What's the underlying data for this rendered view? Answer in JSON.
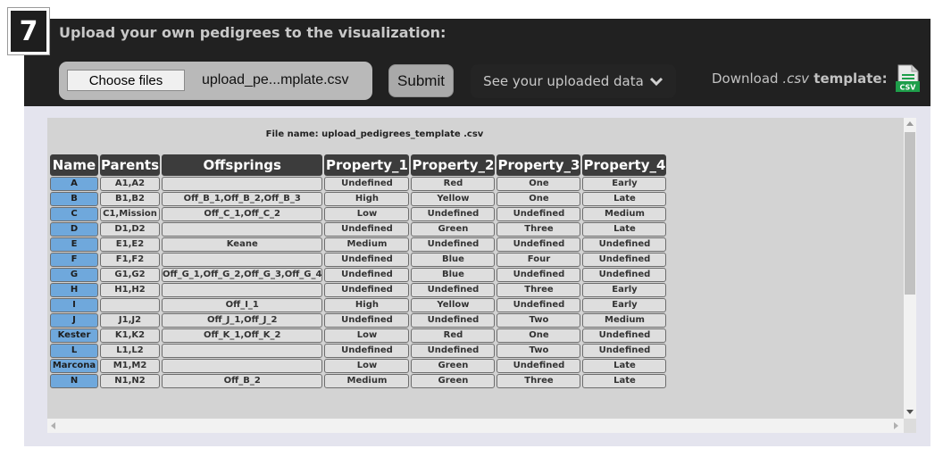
{
  "step_badge": "7",
  "header": {
    "title": "Upload your own pedigrees to the visualization:",
    "choose_files_label": "Choose files",
    "selected_file": "upload_pe...mplate.csv",
    "submit_label": "Submit",
    "see_data_label": "See your uploaded data",
    "download_prefix": "Download ",
    "download_ext": ".csv",
    "download_suffix": " template:",
    "csv_icon_text": "CSV"
  },
  "table": {
    "file_name": "File name: upload_pedigrees_template .csv",
    "columns": [
      "Name",
      "Parents",
      "Offsprings",
      "Property_1",
      "Property_2",
      "Property_3",
      "Property_4"
    ],
    "rows": [
      [
        "A",
        "A1,A2",
        "",
        "Undefined",
        "Red",
        "One",
        "Early"
      ],
      [
        "B",
        "B1,B2",
        "Off_B_1,Off_B_2,Off_B_3",
        "High",
        "Yellow",
        "One",
        "Late"
      ],
      [
        "C",
        "C1,Mission",
        "Off_C_1,Off_C_2",
        "Low",
        "Undefined",
        "Undefined",
        "Medium"
      ],
      [
        "D",
        "D1,D2",
        "",
        "Undefined",
        "Green",
        "Three",
        "Late"
      ],
      [
        "E",
        "E1,E2",
        "Keane",
        "Medium",
        "Undefined",
        "Undefined",
        "Undefined"
      ],
      [
        "F",
        "F1,F2",
        "",
        "Undefined",
        "Blue",
        "Four",
        "Undefined"
      ],
      [
        "G",
        "G1,G2",
        "Off_G_1,Off_G_2,Off_G_3,Off_G_4",
        "Undefined",
        "Blue",
        "Undefined",
        "Undefined"
      ],
      [
        "H",
        "H1,H2",
        "",
        "Undefined",
        "Undefined",
        "Three",
        "Early"
      ],
      [
        "I",
        "",
        "Off_I_1",
        "High",
        "Yellow",
        "Undefined",
        "Early"
      ],
      [
        "J",
        "J1,J2",
        "Off_J_1,Off_J_2",
        "Undefined",
        "Undefined",
        "Two",
        "Medium"
      ],
      [
        "Kester",
        "K1,K2",
        "Off_K_1,Off_K_2",
        "Low",
        "Red",
        "One",
        "Undefined"
      ],
      [
        "L",
        "L1,L2",
        "",
        "Undefined",
        "Undefined",
        "Two",
        "Undefined"
      ],
      [
        "Marcona",
        "M1,M2",
        "",
        "Low",
        "Green",
        "Undefined",
        "Late"
      ],
      [
        "N",
        "N1,N2",
        "Off_B_2",
        "Medium",
        "Green",
        "Three",
        "Late"
      ]
    ]
  },
  "colors": {
    "header_bg": "#212121",
    "name_cell": "#6fa8dc",
    "column_header": "#3c3c3c",
    "csv_icon_green": "#1e9e4a"
  },
  "icons": {
    "dropdown": "chevron-down-icon",
    "csv": "csv-file-icon"
  }
}
